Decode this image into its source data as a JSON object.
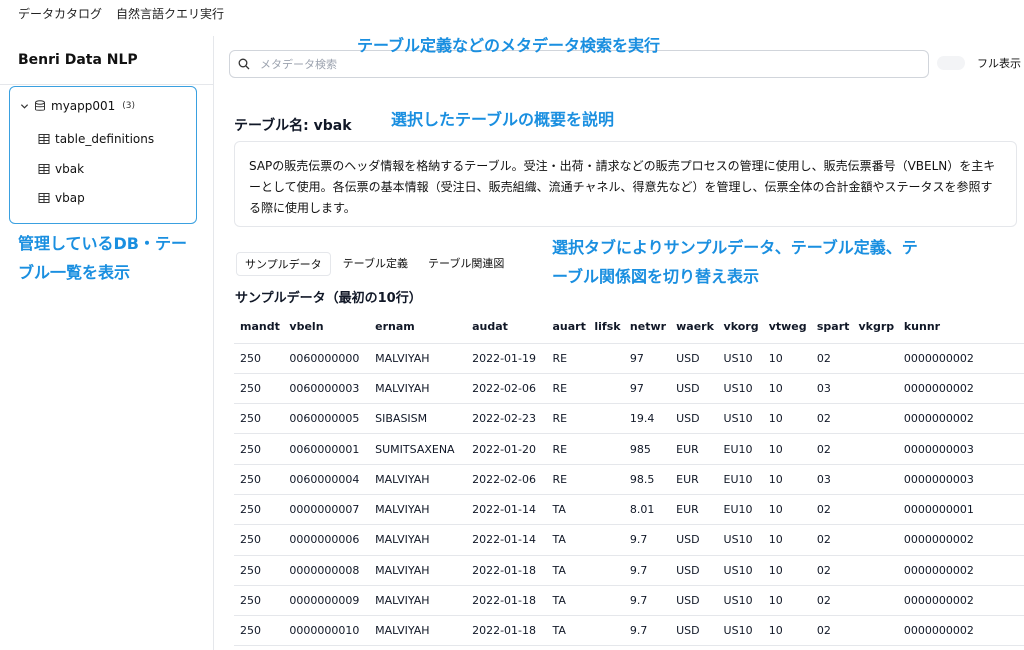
{
  "topnav": {
    "items": [
      "データカタログ",
      "自然言語クエリ実行"
    ]
  },
  "sidebar": {
    "app_title": "Benri Data NLP",
    "db": {
      "name": "myapp001",
      "count": "(3)"
    },
    "tables": [
      "table_definitions",
      "vbak",
      "vbap"
    ]
  },
  "annotations": {
    "search": "テーブル定義などのメタデータ検索を実行",
    "overview": "選択したテーブルの概要を説明",
    "sidebar": "管理しているDB・テーブル一覧を表示",
    "tabs": "選択タブによりサンプルデータ、テーブル定義、テーブル関係図を切り替え表示"
  },
  "search": {
    "placeholder": "メタデータ検索"
  },
  "toggle": {
    "label": "フル表示"
  },
  "table_name": "テーブル名: vbak",
  "description": "SAPの販売伝票のヘッダ情報を格納するテーブル。受注・出荷・請求などの販売プロセスの管理に使用し、販売伝票番号（VBELN）を主キーとして使用。各伝票の基本情報（受注日、販売組織、流通チャネル、得意先など）を管理し、伝票全体の合計金額やステータスを参照する際に使用します。",
  "tabs": [
    "サンプルデータ",
    "テーブル定義",
    "テーブル関連図"
  ],
  "sample": {
    "title": "サンプルデータ（最初の10行）",
    "columns": [
      "mandt",
      "vbeln",
      "ernam",
      "audat",
      "auart",
      "lifsk",
      "netwr",
      "waerk",
      "vkorg",
      "vtweg",
      "spart",
      "vkgrp",
      "kunnr"
    ],
    "rows": [
      [
        "250",
        "0060000000",
        "MALVIYAH",
        "2022-01-19",
        "RE",
        "",
        "97",
        "USD",
        "US10",
        "10",
        "02",
        "",
        "0000000002"
      ],
      [
        "250",
        "0060000003",
        "MALVIYAH",
        "2022-02-06",
        "RE",
        "",
        "97",
        "USD",
        "US10",
        "10",
        "03",
        "",
        "0000000002"
      ],
      [
        "250",
        "0060000005",
        "SIBASISM",
        "2022-02-23",
        "RE",
        "",
        "19.4",
        "USD",
        "US10",
        "10",
        "02",
        "",
        "0000000002"
      ],
      [
        "250",
        "0060000001",
        "SUMITSAXENA",
        "2022-01-20",
        "RE",
        "",
        "985",
        "EUR",
        "EU10",
        "10",
        "02",
        "",
        "0000000003"
      ],
      [
        "250",
        "0060000004",
        "MALVIYAH",
        "2022-02-06",
        "RE",
        "",
        "98.5",
        "EUR",
        "EU10",
        "10",
        "03",
        "",
        "0000000003"
      ],
      [
        "250",
        "0000000007",
        "MALVIYAH",
        "2022-01-14",
        "TA",
        "",
        "8.01",
        "EUR",
        "EU10",
        "10",
        "02",
        "",
        "0000000001"
      ],
      [
        "250",
        "0000000006",
        "MALVIYAH",
        "2022-01-14",
        "TA",
        "",
        "9.7",
        "USD",
        "US10",
        "10",
        "02",
        "",
        "0000000002"
      ],
      [
        "250",
        "0000000008",
        "MALVIYAH",
        "2022-01-18",
        "TA",
        "",
        "9.7",
        "USD",
        "US10",
        "10",
        "02",
        "",
        "0000000002"
      ],
      [
        "250",
        "0000000009",
        "MALVIYAH",
        "2022-01-18",
        "TA",
        "",
        "9.7",
        "USD",
        "US10",
        "10",
        "02",
        "",
        "0000000002"
      ],
      [
        "250",
        "0000000010",
        "MALVIYAH",
        "2022-01-18",
        "TA",
        "",
        "9.7",
        "USD",
        "US10",
        "10",
        "02",
        "",
        "0000000002"
      ]
    ]
  },
  "colors": {
    "accent": "#1a8fe0",
    "border": "#e5e7eb",
    "tree_border": "#3aa0e0"
  }
}
